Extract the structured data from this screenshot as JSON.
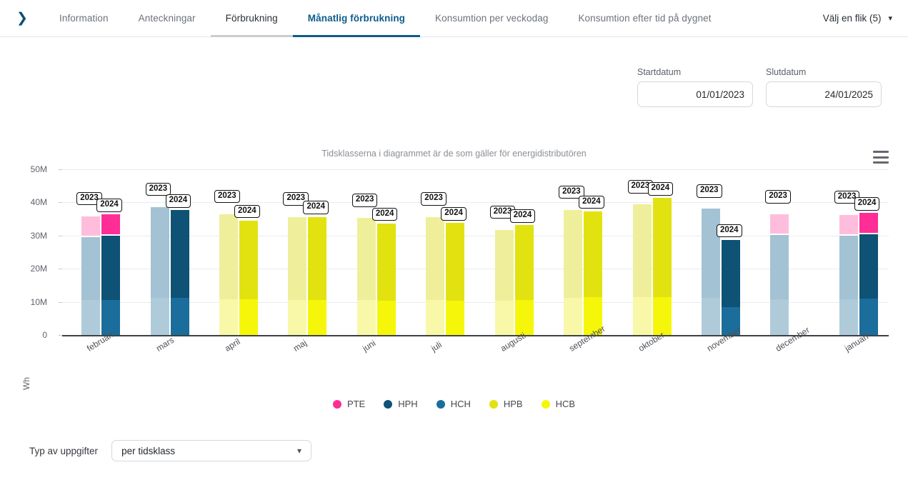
{
  "header": {
    "expand_icon": "chevron-right-icon",
    "tabs": [
      {
        "label": "Information",
        "state": "normal"
      },
      {
        "label": "Anteckningar",
        "state": "normal"
      },
      {
        "label": "Förbrukning",
        "state": "visited"
      },
      {
        "label": "Månatlig förbrukning",
        "state": "active"
      },
      {
        "label": "Konsumtion per veckodag",
        "state": "normal"
      },
      {
        "label": "Konsumtion efter tid på dygnet",
        "state": "normal"
      }
    ],
    "tab_select_label": "Välj en flik (5)",
    "tab_select_icon": "chevron-down-icon"
  },
  "filters": {
    "start": {
      "label": "Startdatum",
      "value": "01/01/2023",
      "placeholder": "dd/mm/yyyy"
    },
    "end": {
      "label": "Slutdatum",
      "value": "24/01/2025",
      "placeholder": "dd/mm/yyyy"
    }
  },
  "chart_menu_icon": "hamburger-menu-icon",
  "footer": {
    "label": "Typ av uppgifter",
    "select_value": "per tidsklass",
    "select_icon": "chevron-down-icon"
  },
  "chart_data": {
    "type": "bar",
    "title": "Tidsklasserna i diagrammet är de som gäller för energidistributören",
    "xlabel": "",
    "ylabel": "Wh",
    "ylim": [
      0,
      50000000
    ],
    "ytick_labels": [
      "0",
      "10M",
      "20M",
      "30M",
      "40M",
      "50M"
    ],
    "ytick_values": [
      0,
      10000000,
      20000000,
      30000000,
      40000000,
      50000000
    ],
    "grid": true,
    "stacked": true,
    "grouped_by": "year",
    "legend_position": "bottom",
    "legend": [
      {
        "name": "PTE",
        "color": "#FF2D96"
      },
      {
        "name": "HPH",
        "color": "#0E5275"
      },
      {
        "name": "HCH",
        "color": "#1B6E9B"
      },
      {
        "name": "HPB",
        "color": "#E2E211"
      },
      {
        "name": "HCB",
        "color": "#F6F60A"
      }
    ],
    "series_colors_2023": {
      "PTE": "#FFBDDD",
      "HPH": "#A3C2D3",
      "HCH": "#AFCBDA",
      "HPB": "#EFEF9B",
      "HCB": "#F8F8A8"
    },
    "categories": [
      "februari",
      "mars",
      "april",
      "maj",
      "juni",
      "juli",
      "augusti",
      "september",
      "oktober",
      "november",
      "december",
      "januari"
    ],
    "group_labels": [
      "2023",
      "2024"
    ],
    "bars": [
      {
        "month": "februari",
        "year": "2023",
        "total": 36300000,
        "segments": [
          {
            "name": "HCH",
            "value": 10600000
          },
          {
            "name": "HPH",
            "value": 19400000
          },
          {
            "name": "PTE",
            "value": 6300000
          }
        ]
      },
      {
        "month": "februari",
        "year": "2024",
        "total": 36800000,
        "segments": [
          {
            "name": "HCH",
            "value": 10600000
          },
          {
            "name": "HPH",
            "value": 19700000
          },
          {
            "name": "PTE",
            "value": 6500000
          }
        ]
      },
      {
        "month": "mars",
        "year": "2023",
        "total": 39100000,
        "segments": [
          {
            "name": "HCH",
            "value": 11300000
          },
          {
            "name": "HPH",
            "value": 27800000
          }
        ]
      },
      {
        "month": "mars",
        "year": "2024",
        "total": 38100000,
        "segments": [
          {
            "name": "HCH",
            "value": 11300000
          },
          {
            "name": "HPH",
            "value": 26800000
          }
        ]
      },
      {
        "month": "april",
        "year": "2023",
        "total": 36900000,
        "segments": [
          {
            "name": "HCB",
            "value": 10700000
          },
          {
            "name": "HPB",
            "value": 26200000
          }
        ]
      },
      {
        "month": "april",
        "year": "2024",
        "total": 35000000,
        "segments": [
          {
            "name": "HCB",
            "value": 10700000
          },
          {
            "name": "HPB",
            "value": 24300000
          }
        ]
      },
      {
        "month": "maj",
        "year": "2023",
        "total": 36100000,
        "segments": [
          {
            "name": "HCB",
            "value": 10500000
          },
          {
            "name": "HPB",
            "value": 25600000
          }
        ]
      },
      {
        "month": "maj",
        "year": "2024",
        "total": 36100000,
        "segments": [
          {
            "name": "HCB",
            "value": 10500000
          },
          {
            "name": "HPB",
            "value": 25600000
          }
        ]
      },
      {
        "month": "juni",
        "year": "2023",
        "total": 35700000,
        "segments": [
          {
            "name": "HCB",
            "value": 10500000
          },
          {
            "name": "HPB",
            "value": 25200000
          }
        ]
      },
      {
        "month": "juni",
        "year": "2024",
        "total": 34100000,
        "segments": [
          {
            "name": "HCB",
            "value": 10400000
          },
          {
            "name": "HPB",
            "value": 23700000
          }
        ]
      },
      {
        "month": "juli",
        "year": "2023",
        "total": 36100000,
        "segments": [
          {
            "name": "HCB",
            "value": 10600000
          },
          {
            "name": "HPB",
            "value": 25500000
          }
        ]
      },
      {
        "month": "juli",
        "year": "2024",
        "total": 34200000,
        "segments": [
          {
            "name": "HCB",
            "value": 10400000
          },
          {
            "name": "HPB",
            "value": 23800000
          }
        ]
      },
      {
        "month": "augusti",
        "year": "2023",
        "total": 32200000,
        "segments": [
          {
            "name": "HCB",
            "value": 10400000
          },
          {
            "name": "HPB",
            "value": 21800000
          }
        ]
      },
      {
        "month": "augusti",
        "year": "2024",
        "total": 33600000,
        "segments": [
          {
            "name": "HCB",
            "value": 10500000
          },
          {
            "name": "HPB",
            "value": 23100000
          }
        ]
      },
      {
        "month": "september",
        "year": "2023",
        "total": 38200000,
        "segments": [
          {
            "name": "HCB",
            "value": 11300000
          },
          {
            "name": "HPB",
            "value": 26900000
          }
        ]
      },
      {
        "month": "september",
        "year": "2024",
        "total": 37800000,
        "segments": [
          {
            "name": "HCB",
            "value": 11400000
          },
          {
            "name": "HPB",
            "value": 26400000
          }
        ]
      },
      {
        "month": "oktober",
        "year": "2023",
        "total": 39800000,
        "segments": [
          {
            "name": "HCB",
            "value": 11500000
          },
          {
            "name": "HPB",
            "value": 28300000
          }
        ]
      },
      {
        "month": "oktober",
        "year": "2024",
        "total": 41800000,
        "segments": [
          {
            "name": "HCB",
            "value": 11500000
          },
          {
            "name": "HPB",
            "value": 30300000
          }
        ]
      },
      {
        "month": "november",
        "year": "2023",
        "total": 38500000,
        "segments": [
          {
            "name": "HCH",
            "value": 11200000
          },
          {
            "name": "HPH",
            "value": 27300000
          }
        ]
      },
      {
        "month": "november",
        "year": "2024",
        "total": 29100000,
        "segments": [
          {
            "name": "HCH",
            "value": 8400000
          },
          {
            "name": "HPH",
            "value": 20700000
          }
        ]
      },
      {
        "month": "december",
        "year": "2023",
        "total": 36800000,
        "segments": [
          {
            "name": "HCH",
            "value": 10700000
          },
          {
            "name": "HPH",
            "value": 19900000
          },
          {
            "name": "PTE",
            "value": 6200000
          }
        ]
      },
      {
        "month": "januari",
        "year": "2023",
        "total": 36700000,
        "segments": [
          {
            "name": "HCH",
            "value": 10700000
          },
          {
            "name": "HPH",
            "value": 19700000
          },
          {
            "name": "PTE",
            "value": 6300000
          }
        ]
      },
      {
        "month": "januari",
        "year": "2024",
        "total": 37200000,
        "segments": [
          {
            "name": "HCH",
            "value": 10900000
          },
          {
            "name": "HPH",
            "value": 19900000
          },
          {
            "name": "PTE",
            "value": 6400000
          }
        ]
      }
    ],
    "annotations": [
      {
        "text": "2023",
        "month": "februari",
        "year": "2023"
      },
      {
        "text": "2024",
        "month": "februari",
        "year": "2024"
      },
      {
        "text": "2023",
        "month": "mars",
        "year": "2023"
      },
      {
        "text": "2024",
        "month": "mars",
        "year": "2024"
      },
      {
        "text": "2023",
        "month": "april",
        "year": "2023"
      },
      {
        "text": "2024",
        "month": "april",
        "year": "2024"
      },
      {
        "text": "2023",
        "month": "maj",
        "year": "2023"
      },
      {
        "text": "2024",
        "month": "maj",
        "year": "2024"
      },
      {
        "text": "2023",
        "month": "juni",
        "year": "2023"
      },
      {
        "text": "2024",
        "month": "juni",
        "year": "2024"
      },
      {
        "text": "2023",
        "month": "juli",
        "year": "2023"
      },
      {
        "text": "2024",
        "month": "juli",
        "year": "2024"
      },
      {
        "text": "2023",
        "month": "augusti",
        "year": "2023"
      },
      {
        "text": "2024",
        "month": "augusti",
        "year": "2024"
      },
      {
        "text": "2023",
        "month": "september",
        "year": "2023"
      },
      {
        "text": "2024",
        "month": "september",
        "year": "2024"
      },
      {
        "text": "2023",
        "month": "oktober",
        "year": "2023"
      },
      {
        "text": "2024",
        "month": "oktober",
        "year": "2024"
      },
      {
        "text": "2023",
        "month": "november",
        "year": "2023"
      },
      {
        "text": "2024",
        "month": "november",
        "year": "2024"
      },
      {
        "text": "2023",
        "month": "december",
        "year": "2023"
      },
      {
        "text": "2023",
        "month": "januari",
        "year": "2023"
      },
      {
        "text": "2024",
        "month": "januari",
        "year": "2024"
      }
    ]
  }
}
